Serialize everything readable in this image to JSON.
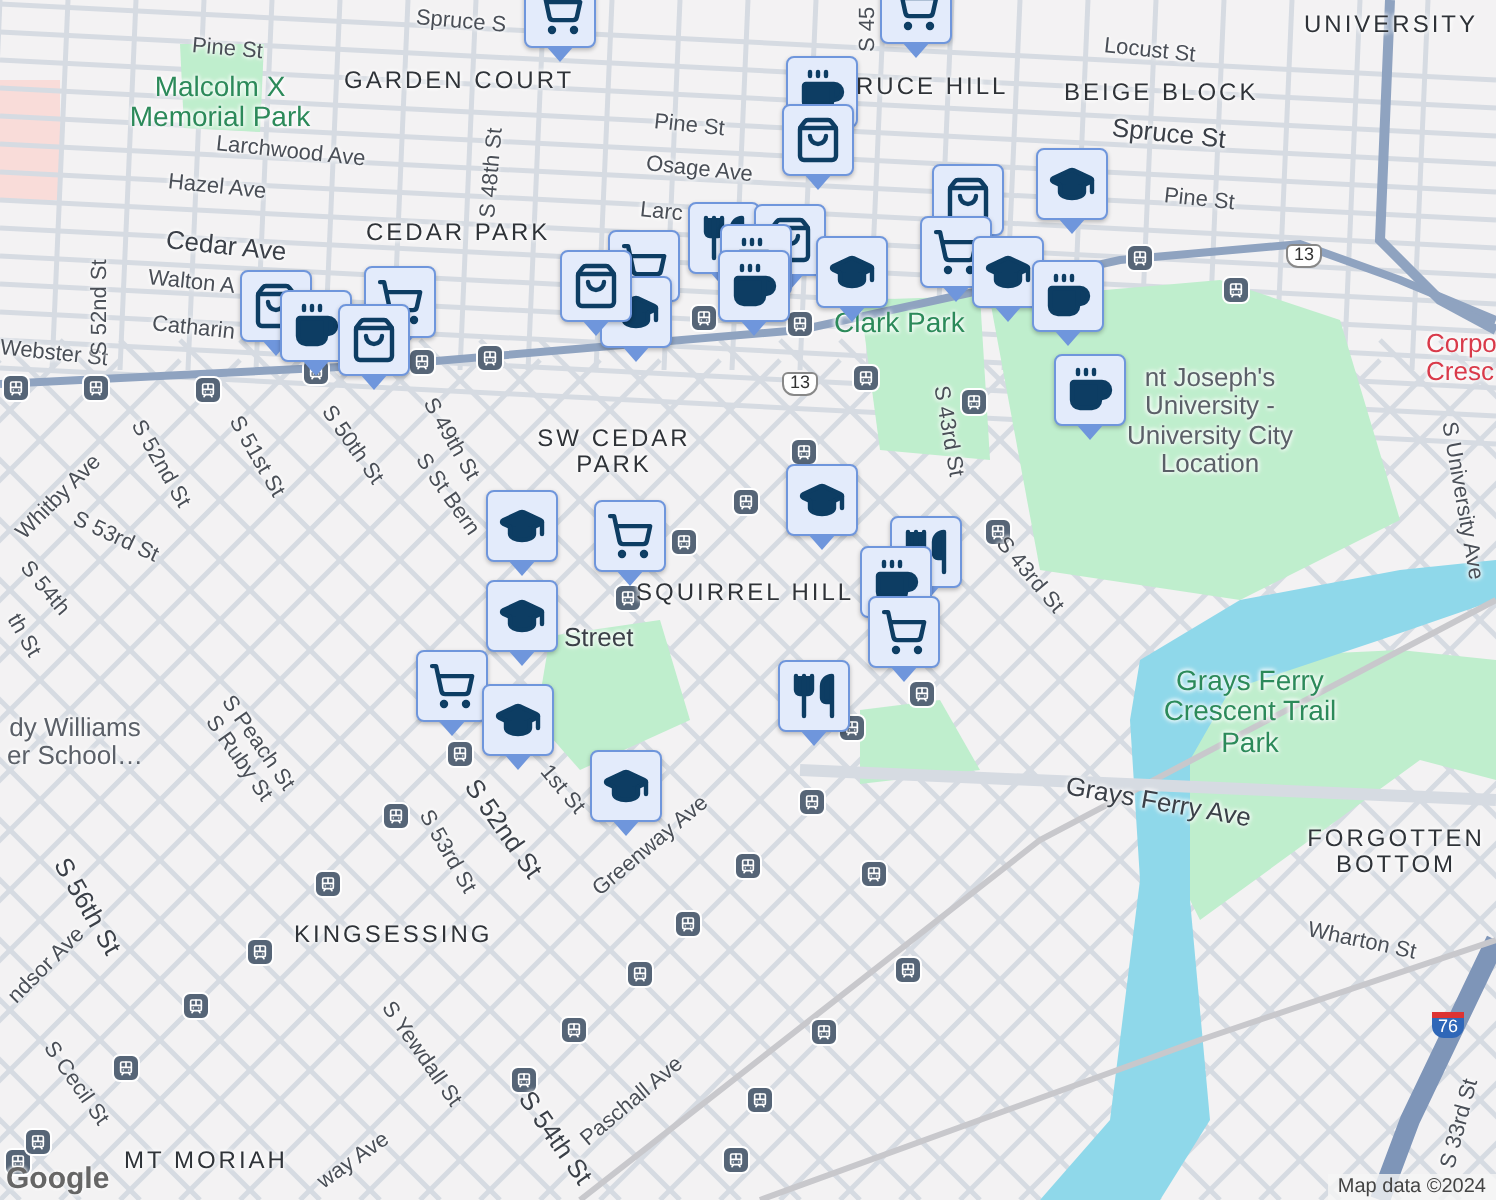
{
  "labels": [
    {
      "kind": "street",
      "text": "Spruce S"
    },
    {
      "kind": "street",
      "text": "Pine St"
    },
    {
      "kind": "park",
      "text": "Malcolm X Memorial Park"
    },
    {
      "kind": "neighborhood",
      "text": "GARDEN COURT"
    },
    {
      "kind": "street",
      "text": "Larchwood Ave"
    },
    {
      "kind": "street",
      "text": "Hazel Ave"
    },
    {
      "kind": "major",
      "text": "Cedar Ave"
    },
    {
      "kind": "street",
      "text": "Walton A"
    },
    {
      "kind": "street",
      "text": "Catharin"
    },
    {
      "kind": "street",
      "text": "Webster St"
    },
    {
      "kind": "street",
      "text": "S 52nd St"
    },
    {
      "kind": "street",
      "text": "S 48th St"
    },
    {
      "kind": "neighborhood",
      "text": "CEDAR PARK"
    },
    {
      "kind": "street",
      "text": "Pine St"
    },
    {
      "kind": "street",
      "text": "Osage Ave"
    },
    {
      "kind": "street",
      "text": "Larc"
    },
    {
      "kind": "route",
      "text": "13"
    },
    {
      "kind": "street",
      "text": "S 51st St"
    },
    {
      "kind": "street",
      "text": "S 50th St"
    },
    {
      "kind": "street",
      "text": "S 49th St"
    },
    {
      "kind": "street",
      "text": "S St Bern"
    },
    {
      "kind": "street",
      "text": "S 52nd St"
    },
    {
      "kind": "street",
      "text": "Whitby Ave"
    },
    {
      "kind": "street",
      "text": "S 53rd St"
    },
    {
      "kind": "street",
      "text": "S 54th"
    },
    {
      "kind": "neighborhood",
      "text": "SW CEDAR PARK"
    },
    {
      "kind": "neighborhood",
      "text": "SQUIRREL HILL"
    },
    {
      "kind": "major",
      "text": "Street"
    },
    {
      "kind": "park",
      "text": "Clark Park"
    },
    {
      "kind": "street",
      "text": "S 43rd St"
    },
    {
      "kind": "poi",
      "text": "nt Joseph's University - University City Location"
    },
    {
      "kind": "neighborhood",
      "text": "UNIVERSITY"
    },
    {
      "kind": "neighborhood",
      "text": "RUCE HILL"
    },
    {
      "kind": "neighborhood",
      "text": "BEIGE BLOCK"
    },
    {
      "kind": "street",
      "text": "Locust St"
    },
    {
      "kind": "major",
      "text": "Spruce St"
    },
    {
      "kind": "street",
      "text": "Pine St"
    },
    {
      "kind": "route",
      "text": "13"
    },
    {
      "kind": "hospital",
      "text": "Corpo Cresc"
    },
    {
      "kind": "street",
      "text": "S University Ave"
    },
    {
      "kind": "street",
      "text": "S 43rd St"
    },
    {
      "kind": "poi",
      "text": "dy Williams er School…"
    },
    {
      "kind": "street",
      "text": "S Peach St"
    },
    {
      "kind": "street",
      "text": "S Ruby St"
    },
    {
      "kind": "major",
      "text": "S 56th St"
    },
    {
      "kind": "street",
      "text": "ndsor Ave"
    },
    {
      "kind": "street",
      "text": "S Cecil St"
    },
    {
      "kind": "neighborhood",
      "text": "MT MORIAH"
    },
    {
      "kind": "street",
      "text": "S 53rd St"
    },
    {
      "kind": "major",
      "text": "S 52nd St"
    },
    {
      "kind": "street",
      "text": "1st St"
    },
    {
      "kind": "street",
      "text": "Greenway Ave"
    },
    {
      "kind": "neighborhood",
      "text": "KINGSESSING"
    },
    {
      "kind": "street",
      "text": "S Yewdall St"
    },
    {
      "kind": "major",
      "text": "S 54th St"
    },
    {
      "kind": "street",
      "text": "Paschall Ave"
    },
    {
      "kind": "street",
      "text": "way Ave"
    },
    {
      "kind": "park",
      "text": "Grays Ferry Crescent Trail Park"
    },
    {
      "kind": "major",
      "text": "Grays Ferry Ave"
    },
    {
      "kind": "neighborhood",
      "text": "FORGOTTEN BOTTOM"
    },
    {
      "kind": "street",
      "text": "Wharton St"
    },
    {
      "kind": "street",
      "text": "S 33rd St"
    },
    {
      "kind": "interstate",
      "text": "76"
    },
    {
      "kind": "street",
      "text": "S 45"
    },
    {
      "kind": "street",
      "text": "th St"
    }
  ],
  "markers": [
    {
      "kind": "cart"
    },
    {
      "kind": "cart"
    },
    {
      "kind": "cup"
    },
    {
      "kind": "bag"
    },
    {
      "kind": "cap"
    },
    {
      "kind": "bag"
    },
    {
      "kind": "cart"
    },
    {
      "kind": "cap"
    },
    {
      "kind": "fork"
    },
    {
      "kind": "cart"
    },
    {
      "kind": "bag"
    },
    {
      "kind": "cup"
    },
    {
      "kind": "cap"
    },
    {
      "kind": "cup"
    },
    {
      "kind": "cap"
    },
    {
      "kind": "cup"
    },
    {
      "kind": "bag"
    },
    {
      "kind": "cup"
    },
    {
      "kind": "cart"
    },
    {
      "kind": "bag"
    },
    {
      "kind": "cup"
    },
    {
      "kind": "bag"
    },
    {
      "kind": "cap"
    },
    {
      "kind": "cart"
    },
    {
      "kind": "cap"
    },
    {
      "kind": "cart"
    },
    {
      "kind": "cap"
    },
    {
      "kind": "cap"
    },
    {
      "kind": "cap"
    },
    {
      "kind": "fork"
    },
    {
      "kind": "cup"
    },
    {
      "kind": "cart"
    },
    {
      "kind": "fork"
    }
  ],
  "attribution": "Map data ©2024",
  "logo": "Google"
}
